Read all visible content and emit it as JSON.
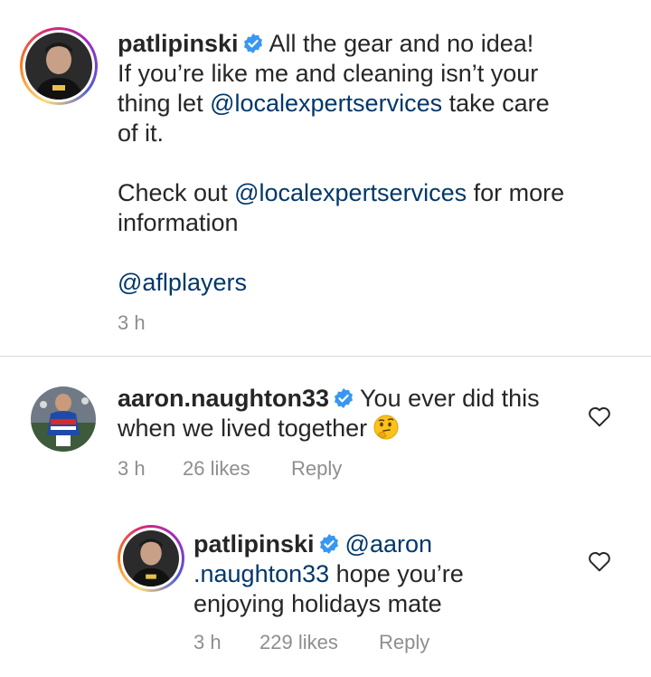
{
  "caption": {
    "username": "patlipinski",
    "line1_text": "All the gear and no idea!",
    "line2_text": "If you’re like me and cleaning isn’t your",
    "line3_pre": "thing let ",
    "line3_mention": "@localexpertservices",
    "line3_post": " take care",
    "line4_text": "of it.",
    "line5_pre": "Check out ",
    "line5_mention": "@localexpertservices",
    "line5_post": " for more",
    "line6_text": "information",
    "line7_mention": "@aflplayers",
    "time": "3 h"
  },
  "comments": [
    {
      "username": "aaron.naughton33",
      "text_line1": "You ever did this",
      "text_line2": "when we lived together",
      "emoji": "thinking-face",
      "time": "3 h",
      "likes": "26 likes",
      "reply_label": "Reply"
    },
    {
      "username": "patlipinski",
      "mention_part1": "@aaron",
      "mention_part2": ".naughton33",
      "text_line2": " hope you’re",
      "text_line3": "enjoying holidays mate",
      "time": "3 h",
      "likes": "229 likes",
      "reply_label": "Reply"
    }
  ],
  "colors": {
    "mention": "#00376b",
    "verified": "#3897f0",
    "meta": "#8e8e8e",
    "text": "#262626"
  },
  "icons": [
    "verified-badge-icon",
    "heart-outline-icon",
    "thinking-face-emoji"
  ]
}
